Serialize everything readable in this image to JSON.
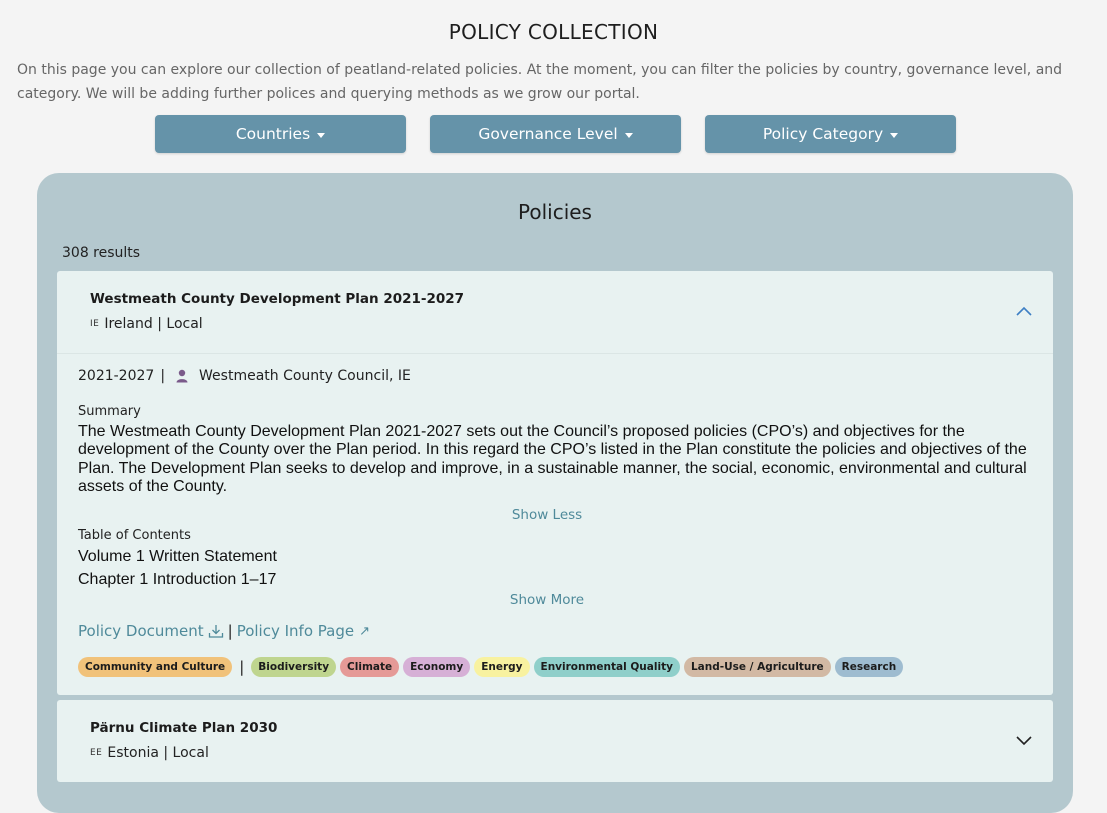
{
  "page": {
    "title": "POLICY COLLECTION",
    "intro": "On this page you can explore our collection of peatland-related policies. At the moment, you can filter the policies by country, governance level, and category. We will be adding further polices and querying methods as we grow our portal."
  },
  "filters": {
    "countries": "Countries",
    "governance": "Governance Level",
    "category": "Policy Category"
  },
  "panel": {
    "title": "Policies",
    "results": "308 results"
  },
  "policies": [
    {
      "title": "Westmeath County Development Plan 2021-2027",
      "country_code": "IE",
      "country": "Ireland",
      "level": "Local",
      "expanded": true,
      "years": "2021-2027",
      "author": "Westmeath County Council, IE",
      "summary_label": "Summary",
      "summary": "The Westmeath County Development Plan 2021-2027 sets out the Council’s proposed policies (CPO’s) and objectives for the development of the County over the Plan period. In this regard the CPO’s listed in the Plan constitute the policies and objectives of the Plan. The Development Plan seeks to develop and improve, in a sustainable manner, the social, economic, environmental and cultural assets of the County.",
      "show_less": "Show Less",
      "toc_label": "Table of Contents",
      "toc": [
        "Volume 1 Written Statement",
        "Chapter 1 Introduction 1–17"
      ],
      "show_more": "Show More",
      "doc_link": "Policy Document",
      "info_link": "Policy Info Page",
      "tags": [
        {
          "label": "Community and Culture",
          "color": "#f1c27a"
        },
        {
          "label": "Biodiversity",
          "color": "#bfd58f"
        },
        {
          "label": "Climate",
          "color": "#e59a97"
        },
        {
          "label": "Economy",
          "color": "#d6b0d6"
        },
        {
          "label": "Energy",
          "color": "#f8f2a0"
        },
        {
          "label": "Environmental Quality",
          "color": "#8fcfca"
        },
        {
          "label": "Land-Use / Agriculture",
          "color": "#d2b9a4"
        },
        {
          "label": "Research",
          "color": "#9ebcd0"
        }
      ]
    },
    {
      "title": "Pärnu Climate Plan 2030",
      "country_code": "EE",
      "country": "Estonia",
      "level": "Local",
      "expanded": false
    }
  ],
  "colors": {
    "filter_button": "#6593a9",
    "panel_bg": "#b4c8ce",
    "card_bg": "#e8f2f1",
    "link": "#4f8a9a",
    "person_icon": "#7a5a8a"
  },
  "icons": {
    "expand": "chevron-up-icon",
    "collapse": "chevron-down-icon",
    "author": "person-icon",
    "download": "download-icon",
    "external": "external-link-icon"
  }
}
